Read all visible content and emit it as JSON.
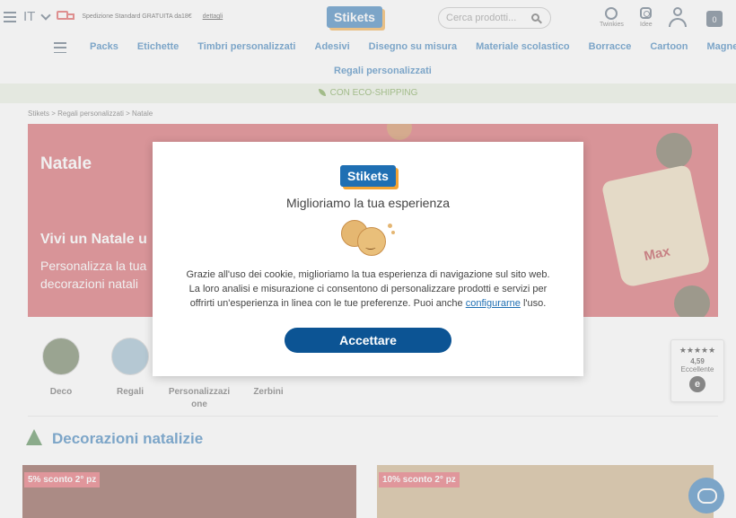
{
  "header": {
    "language": "IT",
    "shipping_text": "Spedizione Standard GRATUITA da18€",
    "shipping_link": "dettagli",
    "logo": "Stikets",
    "search_placeholder": "Cerca prodotti...",
    "twinkies_label": "Twinkies",
    "idee_label": "Idee",
    "cart_count": "0"
  },
  "nav": {
    "items": [
      "Packs",
      "Etichette",
      "Timbri personalizzati",
      "Adesivi",
      "Disegno su misura",
      "Materiale scolastico",
      "Borracce",
      "Cartoon",
      "Magneti"
    ],
    "row2": "Regali personalizzati"
  },
  "eco_banner": "CON ECO-SHIPPING",
  "breadcrumb": "Stikets > Regali personalizzati > Natale",
  "banner": {
    "title": "Natale",
    "subtitle": "Vivi un Natale u",
    "desc_line1": "Personalizza la tua",
    "desc_line2": "decorazioni natali",
    "bag_name": "Max"
  },
  "categories": [
    {
      "label": "Deco"
    },
    {
      "label": "Regali"
    },
    {
      "label_line1": "Personalizzazi",
      "label_line2": "one"
    },
    {
      "label": "Zerbini"
    }
  ],
  "section_title": "Decorazioni natalizie",
  "products": [
    {
      "discount": "5% sconto 2° pz"
    },
    {
      "discount": "10% sconto 2° pz"
    }
  ],
  "rating": {
    "stars": "★★★★★",
    "score": "4,59",
    "label": "Eccellente",
    "badge": "e"
  },
  "cookie_modal": {
    "logo": "Stikets",
    "title": "Miglioriamo la tua esperienza",
    "text_line1": "Grazie all'uso dei cookie, miglioriamo la tua esperienza di navigazione sul sito web.",
    "text_line2": "La loro analisi e misurazione ci consentono di personalizzare prodotti e servizi per",
    "text_line3_pre": "offrirti un'esperienza in linea con le tue preferenze. Puoi anche ",
    "text_link": "configurarne",
    "text_line3_post": " l'uso.",
    "accept_label": "Accettare"
  },
  "colors": {
    "brand_blue": "#1f6fb3",
    "banner_red": "#d24f57",
    "accept_blue": "#0c5494",
    "eco_green": "#6a9a3a"
  }
}
